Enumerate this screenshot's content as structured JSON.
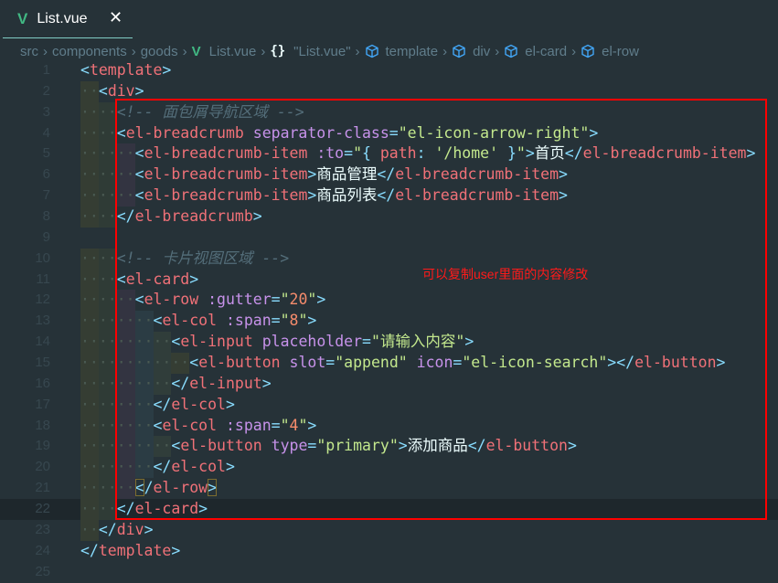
{
  "tab": {
    "icon": "vue-icon",
    "name": "List.vue",
    "close": "✕"
  },
  "breadcrumb": [
    {
      "label": "src",
      "icon": null
    },
    {
      "label": "components",
      "icon": null
    },
    {
      "label": "goods",
      "icon": null
    },
    {
      "label": "List.vue",
      "icon": "vue-icon"
    },
    {
      "label": "\"List.vue\"",
      "icon": "braces-icon"
    },
    {
      "label": "template",
      "icon": "cube-icon"
    },
    {
      "label": "div",
      "icon": "cube-icon"
    },
    {
      "label": "el-card",
      "icon": "cube-icon"
    },
    {
      "label": "el-row",
      "icon": "cube-icon"
    }
  ],
  "colors": {
    "background": "#263238",
    "tag": "#f07178",
    "bracket": "#89ddff",
    "attribute": "#c792ea",
    "string": "#c3e88d",
    "number": "#f78c6c",
    "comment": "#546e7a",
    "annotation": "#ff0000"
  },
  "annotation": "可以复制user里面的内容修改",
  "current_line": 22,
  "lines": [
    {
      "n": "1",
      "indent": 0,
      "tokens": [
        [
          "b",
          "<"
        ],
        [
          "t",
          "template"
        ],
        [
          "b",
          ">"
        ]
      ]
    },
    {
      "n": "2",
      "indent": 1,
      "tokens": [
        [
          "b",
          "<"
        ],
        [
          "t",
          "div"
        ],
        [
          "b",
          ">"
        ]
      ]
    },
    {
      "n": "3",
      "indent": 2,
      "tokens": [
        [
          "c",
          "<!-- 面包屑导航区域 -->"
        ]
      ]
    },
    {
      "n": "4",
      "indent": 2,
      "tokens": [
        [
          "b",
          "<"
        ],
        [
          "t",
          "el-breadcrumb"
        ],
        [
          "x",
          " "
        ],
        [
          "a",
          "separator-class"
        ],
        [
          "b",
          "="
        ],
        [
          "s",
          "\"el-icon-arrow-right\""
        ],
        [
          "b",
          ">"
        ]
      ]
    },
    {
      "n": "5",
      "indent": 3,
      "tokens": [
        [
          "b",
          "<"
        ],
        [
          "t",
          "el-breadcrumb-item"
        ],
        [
          "x",
          " "
        ],
        [
          "a",
          ":to"
        ],
        [
          "b",
          "="
        ],
        [
          "s",
          "\""
        ],
        [
          "o",
          "{ "
        ],
        [
          "p",
          "path"
        ],
        [
          "o",
          ": "
        ],
        [
          "s",
          "'/home'"
        ],
        [
          "o",
          " }"
        ],
        [
          "s",
          "\""
        ],
        [
          "b",
          ">"
        ],
        [
          "x",
          "首页"
        ],
        [
          "b",
          "</"
        ],
        [
          "t",
          "el-breadcrumb-item"
        ],
        [
          "b",
          ">"
        ]
      ]
    },
    {
      "n": "6",
      "indent": 3,
      "tokens": [
        [
          "b",
          "<"
        ],
        [
          "t",
          "el-breadcrumb-item"
        ],
        [
          "b",
          ">"
        ],
        [
          "x",
          "商品管理"
        ],
        [
          "b",
          "</"
        ],
        [
          "t",
          "el-breadcrumb-item"
        ],
        [
          "b",
          ">"
        ]
      ]
    },
    {
      "n": "7",
      "indent": 3,
      "tokens": [
        [
          "b",
          "<"
        ],
        [
          "t",
          "el-breadcrumb-item"
        ],
        [
          "b",
          ">"
        ],
        [
          "x",
          "商品列表"
        ],
        [
          "b",
          "</"
        ],
        [
          "t",
          "el-breadcrumb-item"
        ],
        [
          "b",
          ">"
        ]
      ]
    },
    {
      "n": "8",
      "indent": 2,
      "tokens": [
        [
          "b",
          "</"
        ],
        [
          "t",
          "el-breadcrumb"
        ],
        [
          "b",
          ">"
        ]
      ]
    },
    {
      "n": "9",
      "indent": 0,
      "tokens": []
    },
    {
      "n": "10",
      "indent": 2,
      "tokens": [
        [
          "c",
          "<!-- 卡片视图区域 -->"
        ]
      ]
    },
    {
      "n": "11",
      "indent": 2,
      "tokens": [
        [
          "b",
          "<"
        ],
        [
          "t",
          "el-card"
        ],
        [
          "b",
          ">"
        ]
      ]
    },
    {
      "n": "12",
      "indent": 3,
      "tokens": [
        [
          "b",
          "<"
        ],
        [
          "t",
          "el-row"
        ],
        [
          "x",
          " "
        ],
        [
          "a",
          ":gutter"
        ],
        [
          "b",
          "="
        ],
        [
          "s",
          "\""
        ],
        [
          "n",
          "20"
        ],
        [
          "s",
          "\""
        ],
        [
          "b",
          ">"
        ]
      ]
    },
    {
      "n": "13",
      "indent": 4,
      "tokens": [
        [
          "b",
          "<"
        ],
        [
          "t",
          "el-col"
        ],
        [
          "x",
          " "
        ],
        [
          "a",
          ":span"
        ],
        [
          "b",
          "="
        ],
        [
          "s",
          "\""
        ],
        [
          "n",
          "8"
        ],
        [
          "s",
          "\""
        ],
        [
          "b",
          ">"
        ]
      ]
    },
    {
      "n": "14",
      "indent": 5,
      "tokens": [
        [
          "b",
          "<"
        ],
        [
          "t",
          "el-input"
        ],
        [
          "x",
          " "
        ],
        [
          "a",
          "placeholder"
        ],
        [
          "b",
          "="
        ],
        [
          "s",
          "\"请输入内容\""
        ],
        [
          "b",
          ">"
        ]
      ]
    },
    {
      "n": "15",
      "indent": 6,
      "tokens": [
        [
          "b",
          "<"
        ],
        [
          "t",
          "el-button"
        ],
        [
          "x",
          " "
        ],
        [
          "a",
          "slot"
        ],
        [
          "b",
          "="
        ],
        [
          "s",
          "\"append\""
        ],
        [
          "x",
          " "
        ],
        [
          "a",
          "icon"
        ],
        [
          "b",
          "="
        ],
        [
          "s",
          "\"el-icon-search\""
        ],
        [
          "b",
          "></"
        ],
        [
          "t",
          "el-button"
        ],
        [
          "b",
          ">"
        ]
      ]
    },
    {
      "n": "16",
      "indent": 5,
      "tokens": [
        [
          "b",
          "</"
        ],
        [
          "t",
          "el-input"
        ],
        [
          "b",
          ">"
        ]
      ]
    },
    {
      "n": "17",
      "indent": 4,
      "tokens": [
        [
          "b",
          "</"
        ],
        [
          "t",
          "el-col"
        ],
        [
          "b",
          ">"
        ]
      ]
    },
    {
      "n": "18",
      "indent": 4,
      "tokens": [
        [
          "b",
          "<"
        ],
        [
          "t",
          "el-col"
        ],
        [
          "x",
          " "
        ],
        [
          "a",
          ":span"
        ],
        [
          "b",
          "="
        ],
        [
          "s",
          "\""
        ],
        [
          "n",
          "4"
        ],
        [
          "s",
          "\""
        ],
        [
          "b",
          ">"
        ]
      ]
    },
    {
      "n": "19",
      "indent": 5,
      "tokens": [
        [
          "b",
          "<"
        ],
        [
          "t",
          "el-button"
        ],
        [
          "x",
          " "
        ],
        [
          "a",
          "type"
        ],
        [
          "b",
          "="
        ],
        [
          "s",
          "\"primary\""
        ],
        [
          "b",
          ">"
        ],
        [
          "x",
          "添加商品"
        ],
        [
          "b",
          "</"
        ],
        [
          "t",
          "el-button"
        ],
        [
          "b",
          ">"
        ]
      ]
    },
    {
      "n": "20",
      "indent": 4,
      "tokens": [
        [
          "b",
          "</"
        ],
        [
          "t",
          "el-col"
        ],
        [
          "b",
          ">"
        ]
      ]
    },
    {
      "n": "21",
      "indent": 3,
      "tokens": [
        [
          "m",
          "<"
        ],
        [
          "b",
          "/"
        ],
        [
          "t",
          "el-row"
        ],
        [
          "m",
          ">"
        ]
      ]
    },
    {
      "n": "22",
      "indent": 2,
      "tokens": [
        [
          "b",
          "</"
        ],
        [
          "t",
          "el-card"
        ],
        [
          "b",
          ">"
        ]
      ]
    },
    {
      "n": "23",
      "indent": 1,
      "tokens": [
        [
          "b",
          "</"
        ],
        [
          "t",
          "div"
        ],
        [
          "b",
          ">"
        ]
      ]
    },
    {
      "n": "24",
      "indent": 0,
      "tokens": [
        [
          "b",
          "</"
        ],
        [
          "t",
          "template"
        ],
        [
          "b",
          ">"
        ]
      ]
    },
    {
      "n": "25",
      "indent": 0,
      "tokens": []
    }
  ]
}
